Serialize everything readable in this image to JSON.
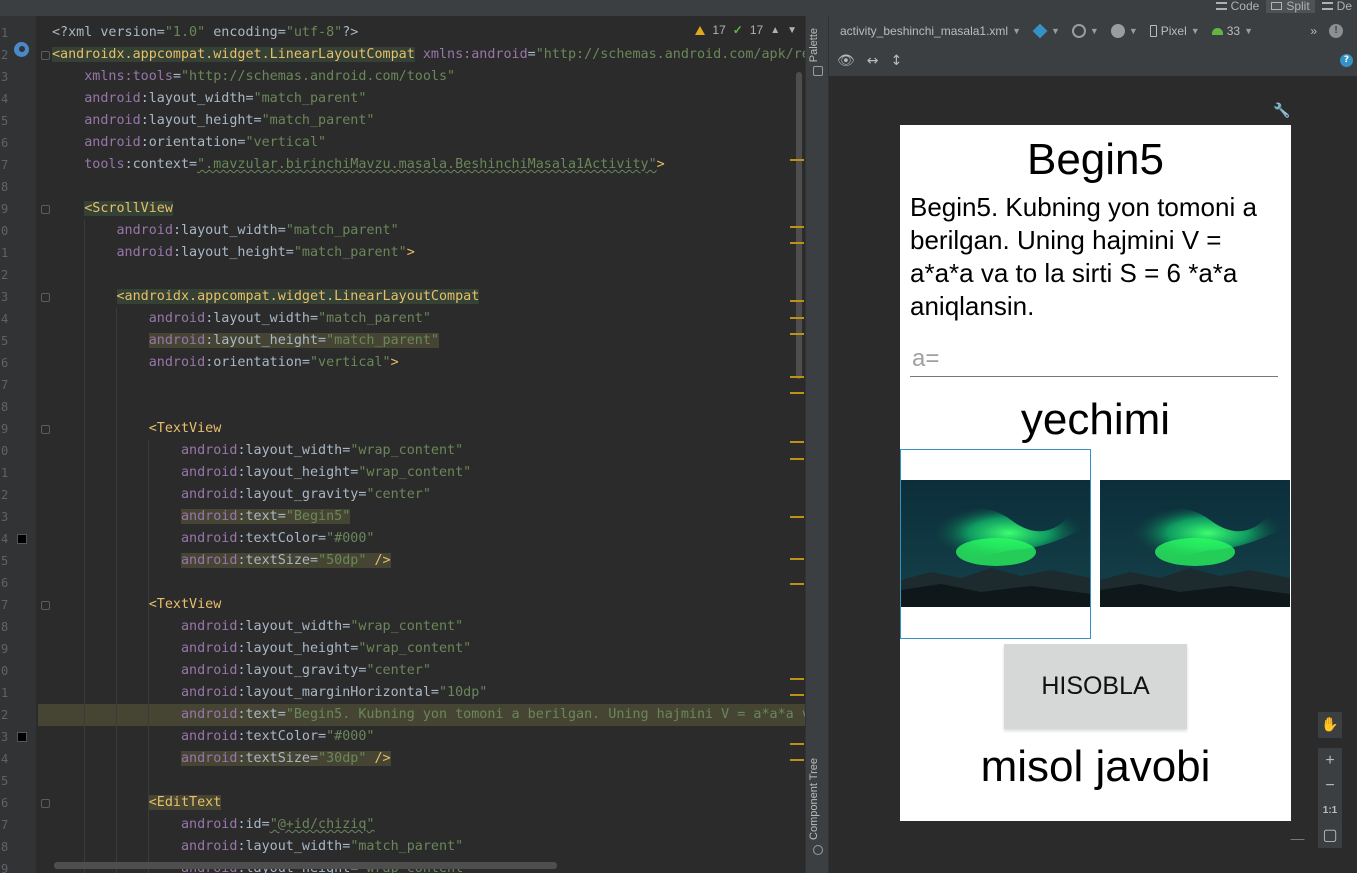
{
  "view_modes": [
    {
      "label": "Code",
      "active": false
    },
    {
      "label": "Split",
      "active": true
    },
    {
      "label": "De",
      "active": false
    }
  ],
  "editor": {
    "inspections": {
      "warnings": "17",
      "typos": "17"
    },
    "line_numbers": [
      "1",
      "2",
      "3",
      "4",
      "5",
      "6",
      "7",
      "8",
      "9",
      "0",
      "1",
      "2",
      "3",
      "4",
      "5",
      "6",
      "7",
      "8",
      "9",
      "0",
      "1",
      "2",
      "3",
      "4",
      "5",
      "6",
      "7",
      "8",
      "9",
      "0",
      "1",
      "2",
      "3",
      "4",
      "5",
      "6",
      "7",
      "8",
      "9"
    ],
    "lines": [
      [
        [
          "p",
          "<?xml version="
        ],
        [
          "v",
          "\"1.0\""
        ],
        [
          "p",
          " encoding="
        ],
        [
          "v",
          "\"utf-8\""
        ],
        [
          "p",
          "?>"
        ]
      ],
      [
        [
          "t",
          "<androidx.appcompat.widget.LinearLayoutCompat"
        ],
        [
          "p",
          " "
        ],
        [
          "a",
          "xmlns:android"
        ],
        [
          "p",
          "="
        ],
        [
          "v",
          "\"http://schemas.android.com/apk/res/android\""
        ]
      ],
      [
        [
          "p",
          "    "
        ],
        [
          "a",
          "xmlns:tools"
        ],
        [
          "p",
          "="
        ],
        [
          "v",
          "\"http://schemas.android.com/tools\""
        ]
      ],
      [
        [
          "p",
          "    "
        ],
        [
          "a",
          "android"
        ],
        [
          "p",
          ":layout_width="
        ],
        [
          "v",
          "\"match_parent\""
        ]
      ],
      [
        [
          "p",
          "    "
        ],
        [
          "a",
          "android"
        ],
        [
          "p",
          ":layout_height="
        ],
        [
          "v",
          "\"match_parent\""
        ]
      ],
      [
        [
          "p",
          "    "
        ],
        [
          "a",
          "android"
        ],
        [
          "p",
          ":orientation="
        ],
        [
          "v",
          "\"vertical\""
        ]
      ],
      [
        [
          "p",
          "    "
        ],
        [
          "a",
          "tools"
        ],
        [
          "p",
          ":context="
        ],
        [
          "v",
          "\".mavzular.birinchiMavzu.masala.BeshinchiMasala1Activity\""
        ],
        [
          "t",
          ">"
        ]
      ],
      [],
      [
        [
          "p",
          "    "
        ],
        [
          "t",
          "<ScrollView"
        ]
      ],
      [
        [
          "p",
          "        "
        ],
        [
          "a",
          "android"
        ],
        [
          "p",
          ":layout_width="
        ],
        [
          "v",
          "\"match_parent\""
        ]
      ],
      [
        [
          "p",
          "        "
        ],
        [
          "a",
          "android"
        ],
        [
          "p",
          ":layout_height="
        ],
        [
          "v",
          "\"match_parent\""
        ],
        [
          "t",
          ">"
        ]
      ],
      [],
      [
        [
          "p",
          "        "
        ],
        [
          "t",
          "<androidx.appcompat.widget.LinearLayoutCompat"
        ]
      ],
      [
        [
          "p",
          "            "
        ],
        [
          "a",
          "android"
        ],
        [
          "p",
          ":layout_width="
        ],
        [
          "v",
          "\"match_parent\""
        ]
      ],
      [
        [
          "p",
          "            "
        ],
        [
          "a",
          "android"
        ],
        [
          "p",
          ":layout_height="
        ],
        [
          "v",
          "\"match_parent\""
        ]
      ],
      [
        [
          "p",
          "            "
        ],
        [
          "a",
          "android"
        ],
        [
          "p",
          ":orientation="
        ],
        [
          "v",
          "\"vertical\""
        ],
        [
          "t",
          ">"
        ]
      ],
      [],
      [],
      [
        [
          "p",
          "            "
        ],
        [
          "t",
          "<TextView"
        ]
      ],
      [
        [
          "p",
          "                "
        ],
        [
          "a",
          "android"
        ],
        [
          "p",
          ":layout_width="
        ],
        [
          "v",
          "\"wrap_content\""
        ]
      ],
      [
        [
          "p",
          "                "
        ],
        [
          "a",
          "android"
        ],
        [
          "p",
          ":layout_height="
        ],
        [
          "v",
          "\"wrap_content\""
        ]
      ],
      [
        [
          "p",
          "                "
        ],
        [
          "a",
          "android"
        ],
        [
          "p",
          ":layout_gravity="
        ],
        [
          "v",
          "\"center\""
        ]
      ],
      [
        [
          "p",
          "                "
        ],
        [
          "a",
          "android"
        ],
        [
          "p",
          ":text="
        ],
        [
          "v",
          "\"Begin5\""
        ]
      ],
      [
        [
          "p",
          "                "
        ],
        [
          "a",
          "android"
        ],
        [
          "p",
          ":textColor="
        ],
        [
          "v",
          "\"#000\""
        ]
      ],
      [
        [
          "p",
          "                "
        ],
        [
          "a",
          "android"
        ],
        [
          "p",
          ":textSize="
        ],
        [
          "v",
          "\"50dp\""
        ],
        [
          "t",
          " />"
        ]
      ],
      [],
      [
        [
          "p",
          "            "
        ],
        [
          "t",
          "<TextView"
        ]
      ],
      [
        [
          "p",
          "                "
        ],
        [
          "a",
          "android"
        ],
        [
          "p",
          ":layout_width="
        ],
        [
          "v",
          "\"wrap_content\""
        ]
      ],
      [
        [
          "p",
          "                "
        ],
        [
          "a",
          "android"
        ],
        [
          "p",
          ":layout_height="
        ],
        [
          "v",
          "\"wrap_content\""
        ]
      ],
      [
        [
          "p",
          "                "
        ],
        [
          "a",
          "android"
        ],
        [
          "p",
          ":layout_gravity="
        ],
        [
          "v",
          "\"center\""
        ]
      ],
      [
        [
          "p",
          "                "
        ],
        [
          "a",
          "android"
        ],
        [
          "p",
          ":layout_marginHorizontal="
        ],
        [
          "v",
          "\"10dp\""
        ]
      ],
      [
        [
          "p",
          "                "
        ],
        [
          "a",
          "android"
        ],
        [
          "p",
          ":text="
        ],
        [
          "v",
          "\"Begin5. Kubning yon tomoni a berilgan. Uning hajmini V = a*a*a v"
        ]
      ],
      [
        [
          "p",
          "                "
        ],
        [
          "a",
          "android"
        ],
        [
          "p",
          ":textColor="
        ],
        [
          "v",
          "\"#000\""
        ]
      ],
      [
        [
          "p",
          "                "
        ],
        [
          "a",
          "android"
        ],
        [
          "p",
          ":textSize="
        ],
        [
          "v",
          "\"30dp\""
        ],
        [
          "t",
          " />"
        ]
      ],
      [],
      [
        [
          "p",
          "            "
        ],
        [
          "t",
          "<EditText"
        ]
      ],
      [
        [
          "p",
          "                "
        ],
        [
          "a",
          "android"
        ],
        [
          "p",
          ":id="
        ],
        [
          "v",
          "\"@+id/chiziq\""
        ]
      ],
      [
        [
          "p",
          "                "
        ],
        [
          "a",
          "android"
        ],
        [
          "p",
          ":layout_width="
        ],
        [
          "v",
          "\"match_parent\""
        ]
      ],
      [
        [
          "p",
          "                "
        ],
        [
          "a",
          "android"
        ],
        [
          "p",
          ":layout_height="
        ],
        [
          "v",
          "\"wrap_content\""
        ]
      ]
    ]
  },
  "tool_strip": {
    "palette": "Palette",
    "component_tree": "Component Tree"
  },
  "design_toolbar": {
    "file_name": "activity_beshinchi_masala1.xml",
    "device": "Pixel",
    "api_level": "33"
  },
  "preview": {
    "title": "Begin5",
    "task_text": "Begin5. Kubning yon tomoni a berilgan. Uning hajmini V = a*a*a va to la sirti S = 6 *a*a aniqlansin.",
    "input_hint": "a=",
    "input_value": "",
    "solution_label": "yechimi",
    "button_label": "HISOBLA",
    "answer_text": "misol javobi"
  },
  "zoom": {
    "plus": "+",
    "minus": "−",
    "one_to_one": "1:1"
  },
  "colors": {
    "tag": "#e8bf6a",
    "attribute": "#9876aa",
    "value": "#6a8759",
    "selection": "#3592c4"
  }
}
